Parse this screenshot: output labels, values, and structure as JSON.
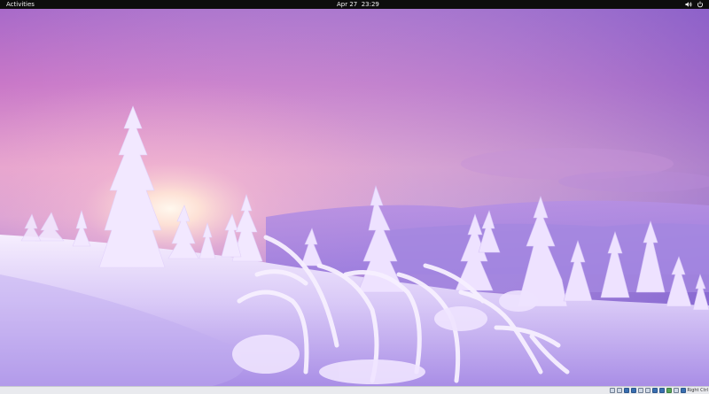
{
  "topbar": {
    "activities_label": "Activities",
    "clock_text": "Apr 27  23:29",
    "icons": [
      "volume-icon",
      "power-icon"
    ]
  },
  "wallpaper": {
    "description_icon": "winter-forest-sunset-wallpaper",
    "sky_top_color": "#a86ac9",
    "sky_glow_color": "#ffd6d0",
    "snow_color": "#f3ecff"
  },
  "bottombar": {
    "host_key_label": "Right Ctrl",
    "status_icons": [
      "hard-disk-icon",
      "optical-drive-icon",
      "audio-icon",
      "network-icon",
      "usb-icon",
      "shared-folder-icon",
      "display-icon",
      "video-capture-icon",
      "cpu-icon",
      "mouse-integration-icon",
      "keyboard-icon"
    ]
  }
}
